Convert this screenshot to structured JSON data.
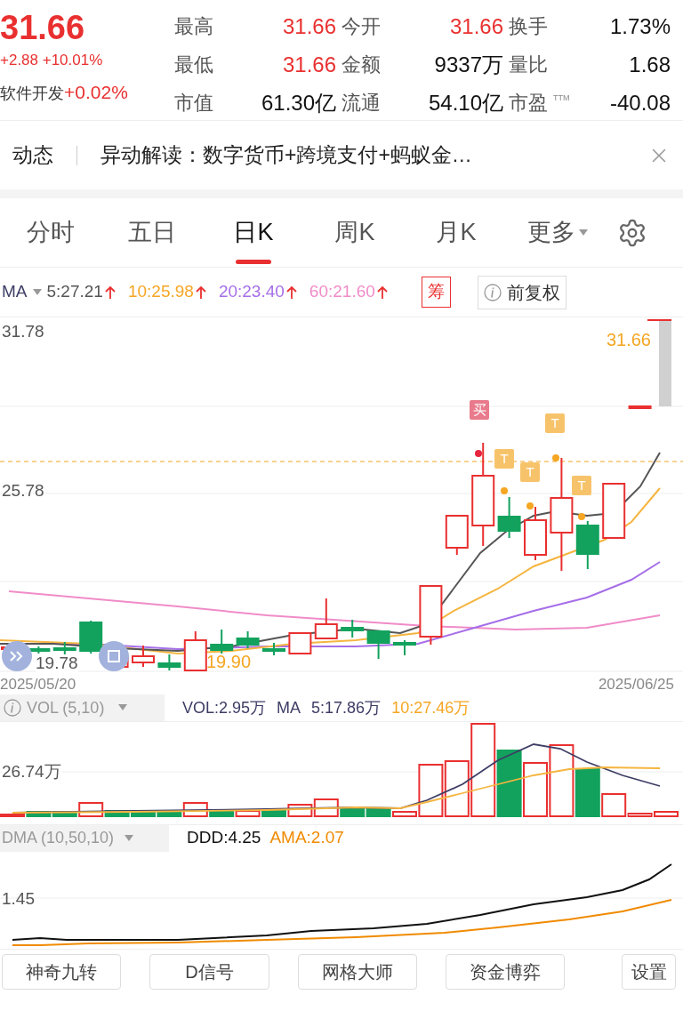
{
  "quote": {
    "price": "31.66",
    "change": "+2.88 +10.01%",
    "sector": {
      "name": "软件开发",
      "change": "+0.02%"
    }
  },
  "stats": [
    {
      "label": "最高",
      "value": "31.66",
      "rising": true
    },
    {
      "label": "今开",
      "value": "31.66",
      "rising": true
    },
    {
      "label": "换手",
      "value": "1.73%",
      "rising": false
    },
    {
      "label": "最低",
      "value": "31.66",
      "rising": true
    },
    {
      "label": "金额",
      "value": "9337万",
      "rising": false
    },
    {
      "label": "量比",
      "value": "1.68",
      "rising": false
    },
    {
      "label": "市值",
      "value": "61.30亿",
      "rising": false
    },
    {
      "label": "流通",
      "value": "54.10亿",
      "rising": false
    },
    {
      "label": "市盈",
      "note": "TTM",
      "value": "-40.08",
      "rising": false
    }
  ],
  "news": {
    "tab": "动态",
    "headline": "异动解读：数字货币+跨境支付+蚂蚁金…"
  },
  "period_tabs": [
    {
      "label": "分时",
      "selected": false
    },
    {
      "label": "五日",
      "selected": false
    },
    {
      "label": "日K",
      "selected": true
    },
    {
      "label": "周K",
      "selected": false
    },
    {
      "label": "月K",
      "selected": false
    },
    {
      "label": "更多",
      "selected": false
    }
  ],
  "ma_bar": {
    "name": "MA",
    "items": [
      {
        "label": "5:27.21",
        "color": "#555555"
      },
      {
        "label": "10:25.98",
        "color": "#f5a623"
      },
      {
        "label": "20:23.40",
        "color": "#a66ee8"
      },
      {
        "label": "60:21.60",
        "color": "#f08cc8"
      }
    ],
    "chip": "筹",
    "adjust": "前复权"
  },
  "price_chart": {
    "axis_labels": [
      "31.78",
      "25.78",
      "19.78"
    ],
    "last_price": "31.66",
    "low_label": "19.90",
    "signals": [
      "买",
      "T",
      "T",
      "T",
      "T"
    ],
    "dates": [
      "2025/05/20",
      "2025/06/25"
    ]
  },
  "vol": {
    "name": "VOL (5,10)",
    "readings": [
      {
        "label": "VOL:2.95万",
        "color": "#3d3d66"
      },
      {
        "label": "MA",
        "color": "#3d3d66"
      },
      {
        "label": "5:17.86万",
        "color": "#3d3d66"
      },
      {
        "label": "10:27.46万",
        "color": "#f5a623"
      }
    ],
    "axis_label": "26.74万"
  },
  "dma": {
    "name": "DMA (10,50,10)",
    "readings": [
      {
        "label": "DDD:4.25",
        "color": "#111111"
      },
      {
        "label": "AMA:2.07",
        "color": "#f08a00"
      }
    ],
    "axis_label": "1.45"
  },
  "tools": [
    "神奇九转",
    "D信号",
    "网格大师",
    "资金博弈"
  ],
  "settings": "设置"
}
